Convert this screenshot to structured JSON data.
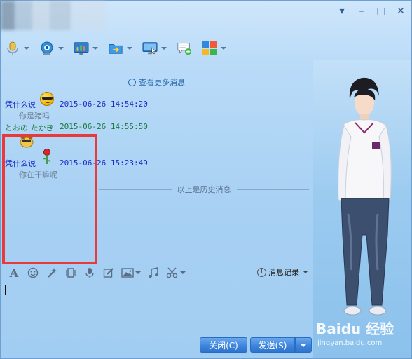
{
  "window": {
    "controls": [
      "▾",
      "–",
      "□",
      "✕"
    ]
  },
  "toolbar": {
    "items": [
      {
        "icon": "microphone-icon"
      },
      {
        "icon": "video-camera-icon"
      },
      {
        "icon": "screen-share-icon"
      },
      {
        "icon": "file-transfer-icon"
      },
      {
        "icon": "remote-desktop-icon"
      },
      {
        "icon": "new-chat-icon"
      },
      {
        "icon": "apps-icon"
      }
    ]
  },
  "chat": {
    "more_messages": "查看更多消息",
    "messages": [
      {
        "sender": "凭什么说",
        "time": "2015-06-26 14:54:20",
        "text": "你是猪吗"
      },
      {
        "sender": "とおの たかき",
        "time": "2015-06-26 14:55:50",
        "text": ""
      },
      {
        "sender": "凭什么说",
        "time": "2015-06-26 15:23:49",
        "text": "你在干嘛呢"
      }
    ],
    "history_divider": "以上是历史消息"
  },
  "format_toolbar": {
    "history_label": "消息记录"
  },
  "buttons": {
    "close": "关闭(C)",
    "send": "发送(S)"
  },
  "watermark": {
    "main": "Baidu 经验",
    "sub": "jingyan.baidu.com"
  },
  "colors": {
    "sender_a": "#1a2bc8",
    "sender_b": "#167a3a",
    "highlight_box": "#e83a3a",
    "button": "#3d85dd"
  }
}
